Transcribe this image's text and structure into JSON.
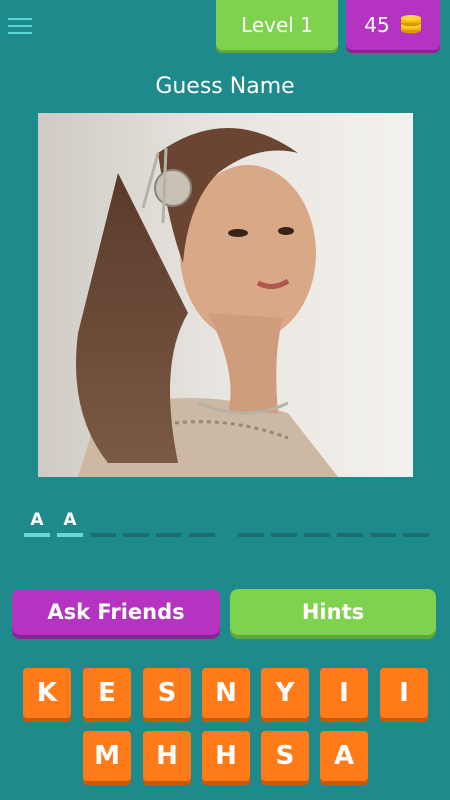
{
  "header": {
    "menu_icon": "hamburger-menu-icon",
    "level_label": "Level 1",
    "coins": "45",
    "coin_icon": "coin-stack-icon"
  },
  "title": "Guess Name",
  "answer": {
    "slots": [
      "A",
      "A",
      "",
      "",
      "",
      "",
      "",
      "",
      "",
      "",
      "",
      "",
      ""
    ]
  },
  "actions": {
    "ask_friends_label": "Ask Friends",
    "hints_label": "Hints"
  },
  "keyboard": {
    "row1": [
      "K",
      "E",
      "S",
      "N",
      "Y",
      "I",
      "I"
    ],
    "row2": [
      "M",
      "H",
      "H",
      "S",
      "A"
    ]
  },
  "colors": {
    "background": "#1f8a8c",
    "purple": "#b433c0",
    "green": "#7fd24e",
    "orange": "#ff7b1a",
    "slot_filled": "#6fd6d8",
    "slot_empty": "#1a6e70"
  }
}
